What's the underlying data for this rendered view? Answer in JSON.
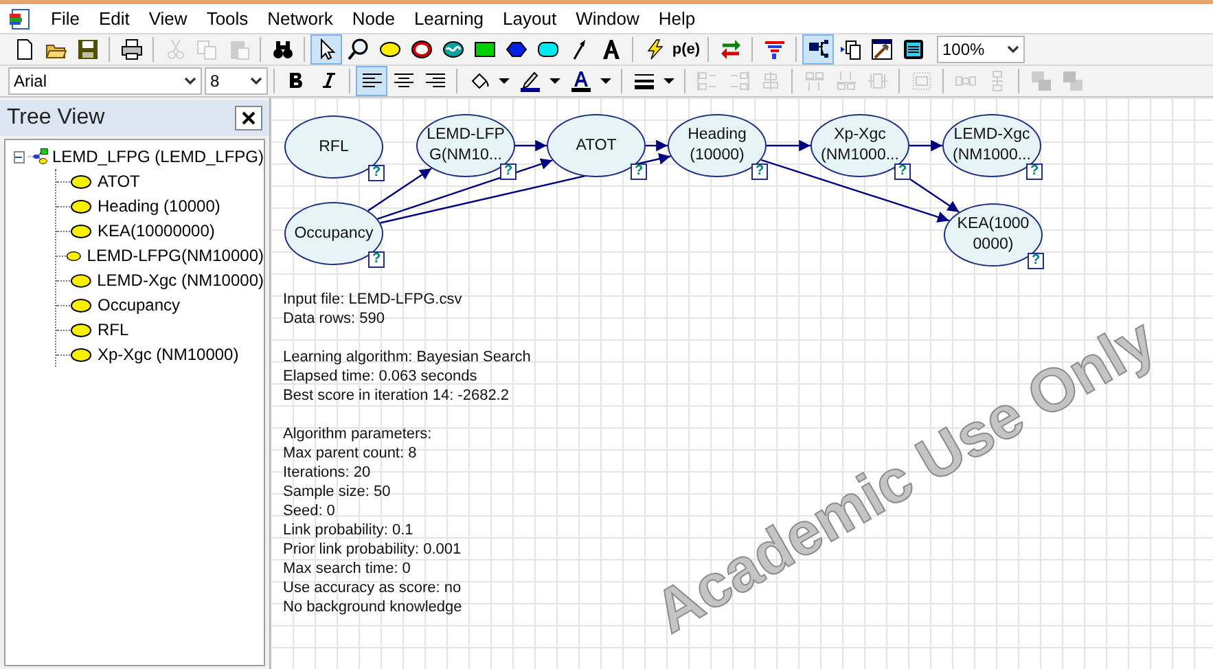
{
  "menu": [
    {
      "label": "File"
    },
    {
      "label": "Edit"
    },
    {
      "label": "View"
    },
    {
      "label": "Tools"
    },
    {
      "label": "Network"
    },
    {
      "label": "Node"
    },
    {
      "label": "Learning"
    },
    {
      "label": "Layout"
    },
    {
      "label": "Window"
    },
    {
      "label": "Help"
    }
  ],
  "toolbar_main": [
    {
      "kind": "new",
      "selected": false,
      "disabled": false
    },
    {
      "kind": "open",
      "selected": false,
      "disabled": false
    },
    {
      "kind": "save",
      "selected": false,
      "disabled": false
    },
    {
      "kind": "separator"
    },
    {
      "kind": "print",
      "selected": false,
      "disabled": false
    },
    {
      "kind": "separator"
    },
    {
      "kind": "cut",
      "selected": false,
      "disabled": true
    },
    {
      "kind": "copy",
      "selected": false,
      "disabled": true
    },
    {
      "kind": "paste",
      "selected": false,
      "disabled": true
    },
    {
      "kind": "separator"
    },
    {
      "kind": "find",
      "selected": false,
      "disabled": false
    },
    {
      "kind": "separator"
    },
    {
      "kind": "pointer",
      "selected": true,
      "disabled": false
    },
    {
      "kind": "zoom",
      "selected": false,
      "disabled": false
    },
    {
      "kind": "chance",
      "selected": false,
      "disabled": false
    },
    {
      "kind": "deterministic",
      "selected": false,
      "disabled": false
    },
    {
      "kind": "equation",
      "selected": false,
      "disabled": false
    },
    {
      "kind": "decision",
      "selected": false,
      "disabled": false
    },
    {
      "kind": "utility",
      "selected": false,
      "disabled": false
    },
    {
      "kind": "submodel",
      "selected": false,
      "disabled": false
    },
    {
      "kind": "arc",
      "selected": false,
      "disabled": false
    },
    {
      "kind": "text",
      "selected": false,
      "disabled": false
    },
    {
      "kind": "separator"
    },
    {
      "kind": "update",
      "selected": false,
      "disabled": false
    },
    {
      "kind": "pe",
      "label": "p(e)",
      "selected": false,
      "disabled": false
    },
    {
      "kind": "separator"
    },
    {
      "kind": "swap",
      "selected": false,
      "disabled": false
    },
    {
      "kind": "separator"
    },
    {
      "kind": "funnel",
      "selected": false,
      "disabled": false
    },
    {
      "kind": "separator"
    },
    {
      "kind": "graph",
      "selected": true,
      "disabled": false
    },
    {
      "kind": "copyview",
      "selected": false,
      "disabled": false
    },
    {
      "kind": "hammer",
      "selected": false,
      "disabled": false
    },
    {
      "kind": "sheet",
      "selected": false,
      "disabled": false
    }
  ],
  "zoom_combo": {
    "value": "100%"
  },
  "font_combo": {
    "value": "Arial"
  },
  "size_combo": {
    "value": "8"
  },
  "toolbar_format": [
    {
      "kind": "separator"
    },
    {
      "kind": "bold",
      "selected": false,
      "disabled": false
    },
    {
      "kind": "italic",
      "selected": false,
      "disabled": false
    },
    {
      "kind": "separator"
    },
    {
      "kind": "align-left",
      "selected": true,
      "disabled": false
    },
    {
      "kind": "align-center",
      "selected": false,
      "disabled": false
    },
    {
      "kind": "align-right",
      "selected": false,
      "disabled": false
    },
    {
      "kind": "separator"
    },
    {
      "kind": "fill",
      "selected": false,
      "disabled": false
    },
    {
      "kind": "caret",
      "selected": false,
      "disabled": false
    },
    {
      "kind": "pen",
      "selected": false,
      "disabled": false
    },
    {
      "kind": "caret",
      "selected": false,
      "disabled": false
    },
    {
      "kind": "font-color",
      "selected": false,
      "disabled": false
    },
    {
      "kind": "caret",
      "selected": false,
      "disabled": false
    },
    {
      "kind": "separator"
    },
    {
      "kind": "line-width",
      "selected": false,
      "disabled": false
    },
    {
      "kind": "caret",
      "selected": false,
      "disabled": false
    },
    {
      "kind": "separator"
    },
    {
      "kind": "align-h",
      "selected": false,
      "disabled": true
    },
    {
      "kind": "align-h2",
      "selected": false,
      "disabled": true
    },
    {
      "kind": "align-c",
      "selected": false,
      "disabled": true
    },
    {
      "kind": "separator"
    },
    {
      "kind": "align-v",
      "selected": false,
      "disabled": true
    },
    {
      "kind": "align-v2",
      "selected": false,
      "disabled": true
    },
    {
      "kind": "align-m",
      "selected": false,
      "disabled": true
    },
    {
      "kind": "separator"
    },
    {
      "kind": "frame",
      "selected": false,
      "disabled": true
    },
    {
      "kind": "separator"
    },
    {
      "kind": "space-h",
      "selected": false,
      "disabled": true
    },
    {
      "kind": "space-v",
      "selected": false,
      "disabled": true
    },
    {
      "kind": "separator"
    },
    {
      "kind": "front",
      "selected": false,
      "disabled": true
    },
    {
      "kind": "back",
      "selected": false,
      "disabled": true
    }
  ],
  "tree_view": {
    "title": "Tree View",
    "root": {
      "label": "LEMD_LFPG (LEMD_LFPG)",
      "expanded": true,
      "children": [
        {
          "label": "ATOT"
        },
        {
          "label": "Heading (10000)"
        },
        {
          "label": "KEA(10000000)"
        },
        {
          "label": "LEMD-LFPG(NM10000)"
        },
        {
          "label": "LEMD-Xgc (NM10000)"
        },
        {
          "label": "Occupancy"
        },
        {
          "label": "RFL"
        },
        {
          "label": "Xp-Xgc (NM10000)"
        }
      ]
    }
  },
  "network": {
    "nodes": [
      {
        "lines": [
          "RFL"
        ],
        "marker": "?"
      },
      {
        "lines": [
          "LEMD-LFP",
          "G(NM10..."
        ],
        "marker": "?"
      },
      {
        "lines": [
          "ATOT"
        ],
        "marker": "?"
      },
      {
        "lines": [
          "Heading",
          "(10000)"
        ],
        "marker": "?"
      },
      {
        "lines": [
          "Xp-Xgc",
          "(NM1000..."
        ],
        "marker": "?"
      },
      {
        "lines": [
          "LEMD-Xgc",
          "(NM1000..."
        ],
        "marker": "?"
      },
      {
        "lines": [
          "Occupancy"
        ],
        "marker": "?"
      },
      {
        "lines": [
          "KEA(1000",
          "0000)"
        ],
        "marker": "?"
      }
    ]
  },
  "log": [
    [
      "Input file: LEMD-LFPG.csv",
      "Data rows: 590"
    ],
    [
      "Learning algorithm: Bayesian Search",
      "Elapsed time: 0.063 seconds",
      "Best score in iteration 14: -2682.2"
    ],
    [
      "Algorithm parameters:",
      "Max parent count: 8",
      "Iterations: 20",
      "Sample size: 50",
      "Seed: 0",
      "Link probability: 0.1",
      "Prior link probability: 0.001",
      "Max search time: 0",
      "Use accuracy as score: no",
      "No background knowledge"
    ]
  ],
  "license_banner": "Academic Use Only"
}
